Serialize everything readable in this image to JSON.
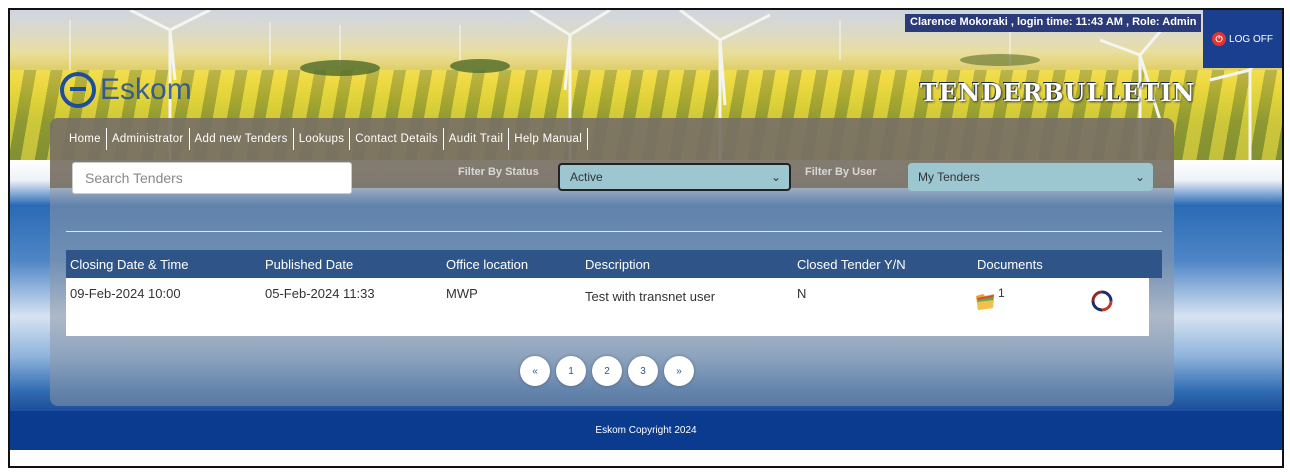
{
  "header": {
    "logo_text": "Eskom",
    "title": "TENDERBULLETIN",
    "user_info": "Clarence Mokoraki , login time: 11:43 AM , Role: Admin",
    "logoff_label": "LOG OFF"
  },
  "nav": {
    "items": [
      {
        "label": "Home"
      },
      {
        "label": "Administrator"
      },
      {
        "label": "Add new Tenders"
      },
      {
        "label": "Lookups"
      },
      {
        "label": "Contact Details"
      },
      {
        "label": "Audit Trail"
      },
      {
        "label": "Help Manual"
      }
    ]
  },
  "filters": {
    "search_placeholder": "Search Tenders",
    "status_label": "Filter By Status",
    "status_value": "Active",
    "user_label": "Filter By User",
    "user_value": "My Tenders"
  },
  "table": {
    "columns": [
      "Closing Date & Time",
      "Published Date",
      "Office location",
      "Description",
      "Closed Tender Y/N",
      "Documents"
    ],
    "rows": [
      {
        "closing": "09-Feb-2024 10:00",
        "published": "05-Feb-2024 11:33",
        "office": "MWP",
        "description": "Test with transnet user",
        "closed": "N",
        "documents": "1"
      }
    ]
  },
  "pagination": {
    "prev": "«",
    "pages": [
      "1",
      "2",
      "3"
    ],
    "next": "»"
  },
  "footer": {
    "text": "Eskom Copyright 2024"
  },
  "colors": {
    "nav_bg": "#786f64",
    "table_header": "#2f5488",
    "footer": "#0b3b8f",
    "select_bg": "#9cc7d1",
    "logoff_bg": "#1b3f8f"
  }
}
